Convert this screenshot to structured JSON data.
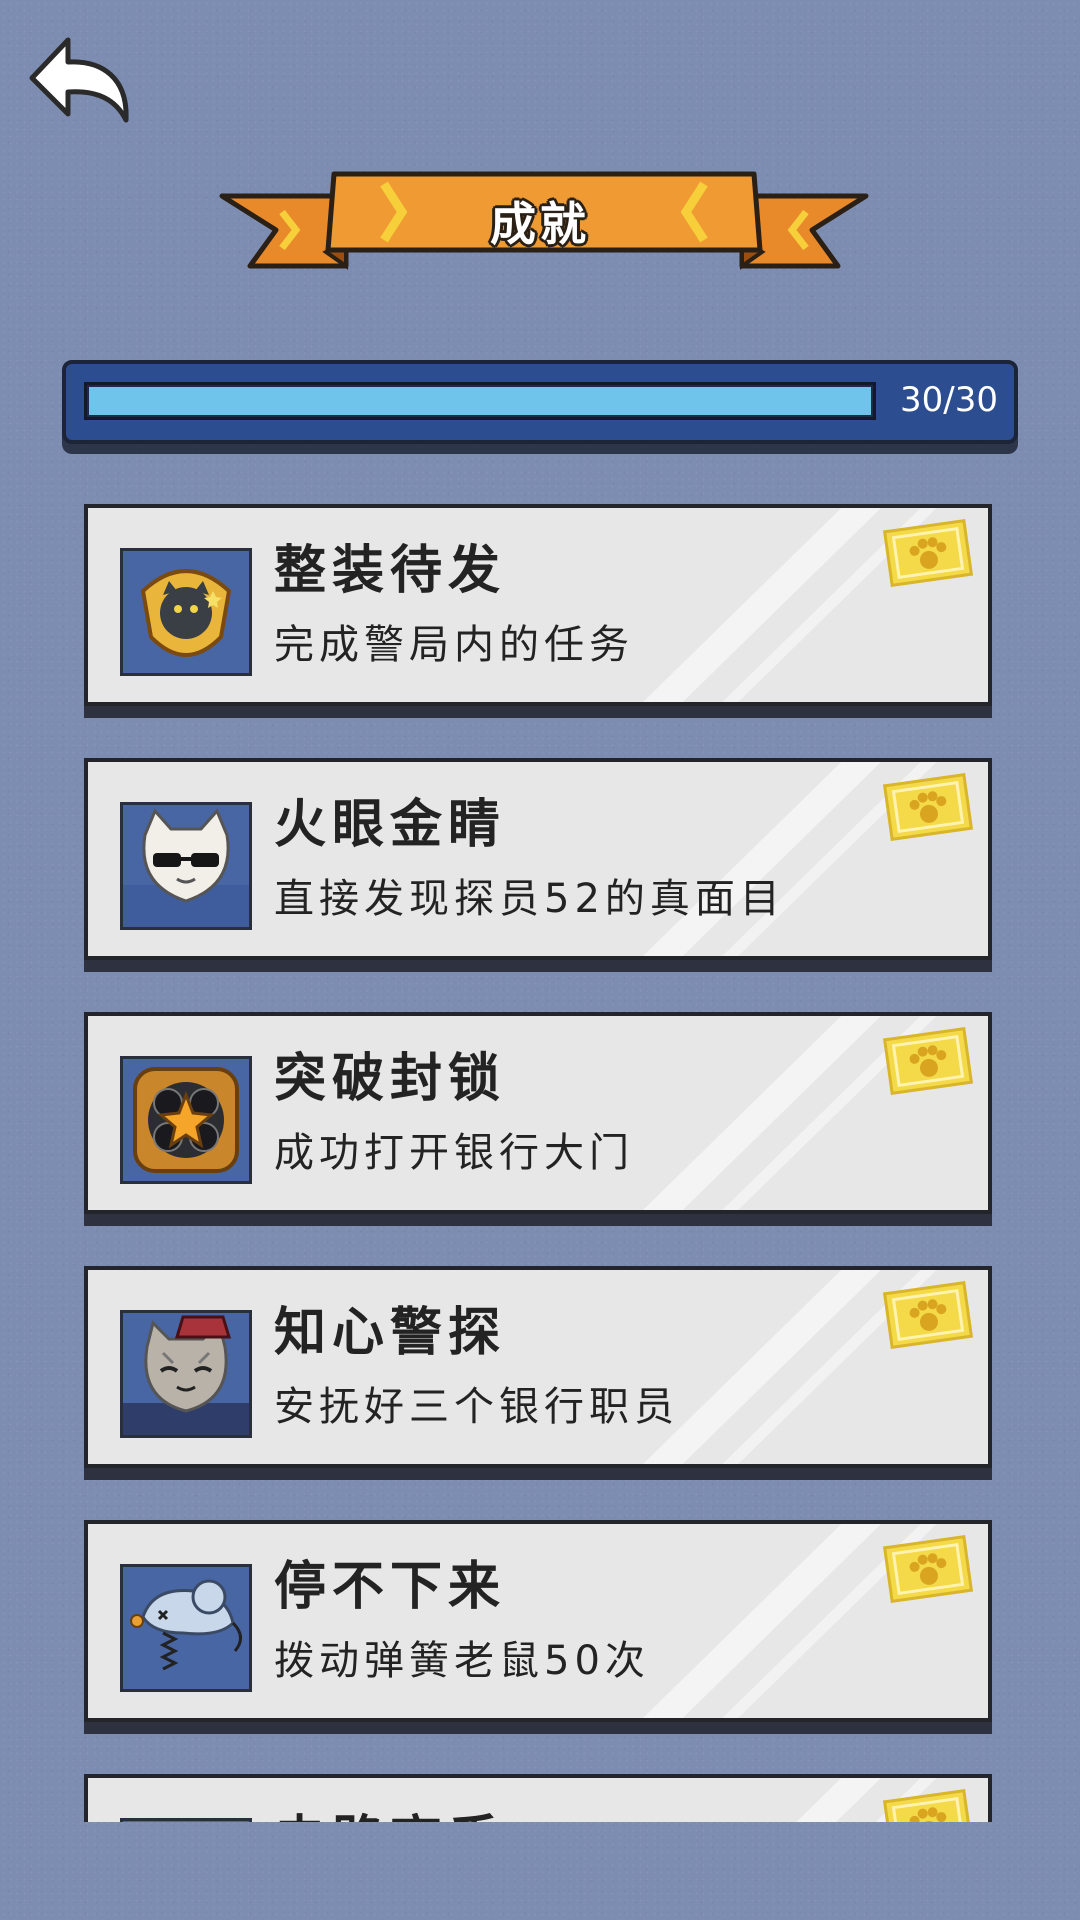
{
  "header": {
    "title": "成就"
  },
  "progress": {
    "current": 30,
    "total": 30,
    "label": "30/30",
    "fill_fraction": 1.0
  },
  "achievements": [
    {
      "title": "整装待发",
      "description": "完成警局内的任务",
      "icon": "police-badge-cat-icon",
      "unlocked": true
    },
    {
      "title": "火眼金睛",
      "description": "直接发现探员52的真面目",
      "icon": "cat-with-sunglasses-icon",
      "unlocked": true
    },
    {
      "title": "突破封锁",
      "description": "成功打开银行大门",
      "icon": "bank-door-lock-icon",
      "unlocked": true
    },
    {
      "title": "知心警探",
      "description": "安抚好三个银行职员",
      "icon": "smiling-cat-detective-icon",
      "unlocked": true
    },
    {
      "title": "停不下来",
      "description": "拨动弹簧老鼠50次",
      "icon": "spring-mouse-toy-icon",
      "unlocked": true
    },
    {
      "title": "电路高手",
      "description": "",
      "icon": "circuit-icon",
      "unlocked": true
    }
  ],
  "colors": {
    "background": "#7d8db1",
    "banner": "#e8892a",
    "progress_fill": "#6ec4ea",
    "progress_frame": "#2c4d8f",
    "card": "#e7e7e7",
    "stamp": "#f2d34a"
  }
}
